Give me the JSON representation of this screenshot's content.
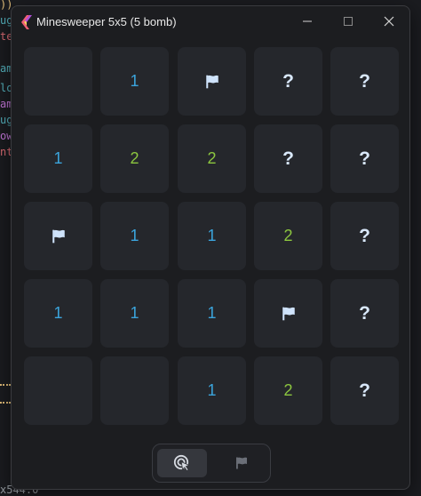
{
  "window": {
    "title": "Minesweeper 5x5 (5 bomb)",
    "controls": [
      "minimize",
      "maximize",
      "close"
    ]
  },
  "background_editor": {
    "visible_fragments": [
      "))",
      "ug",
      "te",
      "am",
      "lo",
      "am",
      "ug",
      "ow",
      "nt"
    ],
    "bottom_fragment": "x544.0"
  },
  "colors": {
    "num_1": "#3ba4dc",
    "num_2": "#8cc63f",
    "question": "#d9e8fb",
    "flag": "#cfe3fb",
    "cell_bg": "#25272c"
  },
  "board": {
    "rows": 5,
    "cols": 5,
    "bombs": 5,
    "cells": [
      [
        {
          "t": "empty",
          "v": ""
        },
        {
          "t": "num",
          "v": "1"
        },
        {
          "t": "flag",
          "v": "flag-icon"
        },
        {
          "t": "q",
          "v": "?"
        },
        {
          "t": "q",
          "v": "?"
        }
      ],
      [
        {
          "t": "num",
          "v": "1"
        },
        {
          "t": "num",
          "v": "2"
        },
        {
          "t": "num",
          "v": "2"
        },
        {
          "t": "q",
          "v": "?"
        },
        {
          "t": "q",
          "v": "?"
        }
      ],
      [
        {
          "t": "flag",
          "v": "flag-icon"
        },
        {
          "t": "num",
          "v": "1"
        },
        {
          "t": "num",
          "v": "1"
        },
        {
          "t": "num",
          "v": "2"
        },
        {
          "t": "q",
          "v": "?"
        }
      ],
      [
        {
          "t": "num",
          "v": "1"
        },
        {
          "t": "num",
          "v": "1"
        },
        {
          "t": "num",
          "v": "1"
        },
        {
          "t": "flag",
          "v": "flag-icon"
        },
        {
          "t": "q",
          "v": "?"
        }
      ],
      [
        {
          "t": "empty",
          "v": ""
        },
        {
          "t": "empty",
          "v": ""
        },
        {
          "t": "num",
          "v": "1"
        },
        {
          "t": "num",
          "v": "2"
        },
        {
          "t": "q",
          "v": "?"
        }
      ]
    ]
  },
  "mode_toggle": {
    "options": [
      {
        "name": "reveal",
        "icon": "tap-icon",
        "selected": true
      },
      {
        "name": "flag",
        "icon": "flag-icon",
        "selected": false
      }
    ]
  }
}
